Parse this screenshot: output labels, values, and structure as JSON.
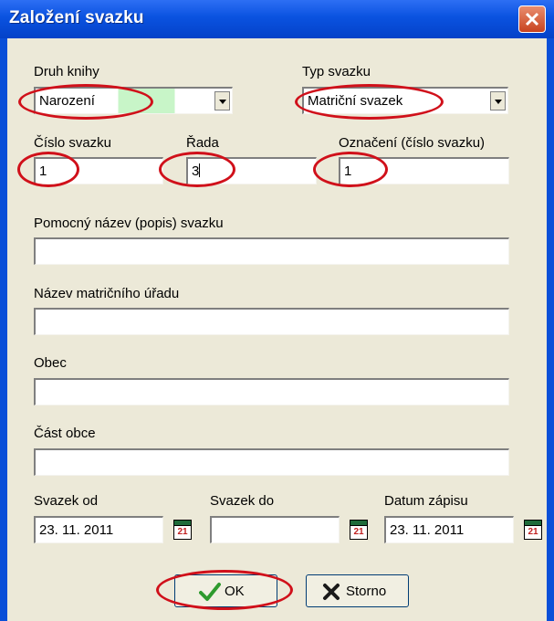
{
  "dialog": {
    "title": "Založení svazku"
  },
  "fields": {
    "druh_knihy": {
      "label": "Druh knihy",
      "value": "Narození"
    },
    "typ_svazku": {
      "label": "Typ svazku",
      "value": "Matriční svazek"
    },
    "cislo_svazku": {
      "label": "Číslo svazku",
      "value": "1"
    },
    "rada": {
      "label": "Řada",
      "value": "3"
    },
    "oznaceni": {
      "label": "Označení (číslo svazku)",
      "value": "1"
    },
    "pomocny_nazev": {
      "label": "Pomocný název (popis) svazku",
      "value": ""
    },
    "nazev_uradu": {
      "label": "Název matričního úřadu",
      "value": ""
    },
    "obec": {
      "label": "Obec",
      "value": ""
    },
    "cast_obce": {
      "label": "Část obce",
      "value": ""
    },
    "svazek_od": {
      "label": "Svazek od",
      "value": "23. 11. 2011"
    },
    "svazek_do": {
      "label": "Svazek do",
      "value": ""
    },
    "datum_zapisu": {
      "label": "Datum zápisu",
      "value": "23. 11. 2011"
    }
  },
  "calendar_icon_day": "21",
  "buttons": {
    "ok": "OK",
    "storno": "Storno"
  },
  "colors": {
    "title_bar": "#0a52e0",
    "dialog_bg": "#ece9d8",
    "druh_knihy_highlight": "#c8f5c8",
    "annotation_oval": "#d0101a"
  }
}
